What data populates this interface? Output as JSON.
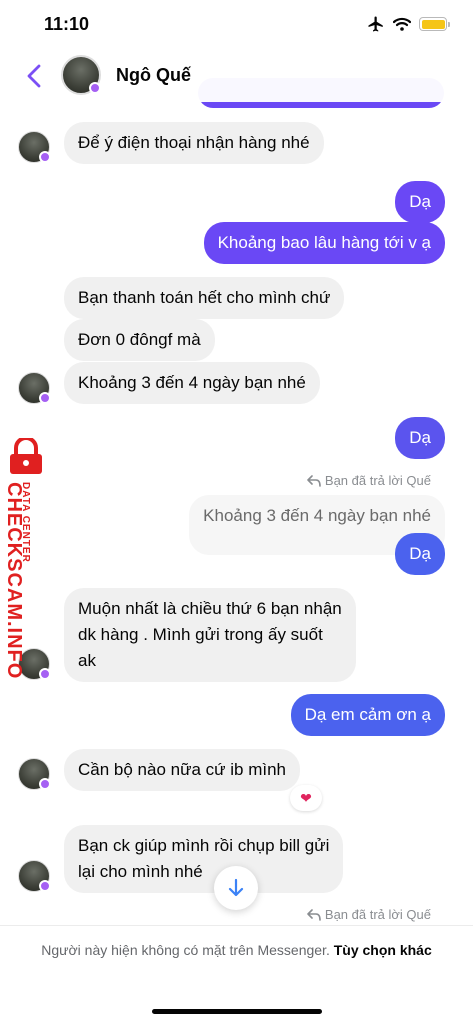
{
  "status_bar": {
    "time": "11:10"
  },
  "header": {
    "contact_name": "Ngô Quế"
  },
  "messages": [
    {
      "text": "Để ý điện thoại nhận hàng nhé"
    },
    {
      "text": "Dạ"
    },
    {
      "text": "Khoảng bao lâu hàng tới v ạ"
    },
    {
      "text": "Bạn thanh toán hết cho mình chứ"
    },
    {
      "text": "Đơn 0 đôngf mà"
    },
    {
      "text": "Khoảng 3 đến 4 ngày bạn nhé"
    },
    {
      "text": "Dạ"
    },
    {
      "text": "Khoảng 3 đến 4 ngày bạn nhé"
    },
    {
      "text": "Dạ"
    },
    {
      "line1": "Muộn nhất là chiều thứ 6 bạn nhận",
      "line2": "dk hàng . Mình gửi trong ấy suốt",
      "line3": "ak"
    },
    {
      "text": "Dạ em cảm ơn ạ"
    },
    {
      "text": "Cần bộ nào nữa cứ ib mình"
    },
    {
      "line1": "Bạn ck giúp mình rồi chụp bill gửi",
      "line2": "lại cho mình nhé"
    }
  ],
  "reply_labels": [
    "Bạn đã trả lời Quế",
    "Bạn đã trả lời Quế"
  ],
  "reaction": "❤",
  "watermark": {
    "text1": "DATA CENTER",
    "text2": "CHECKSCAM.INFO"
  },
  "footer": {
    "text": "Người này hiện không có mặt trên Messenger.",
    "link": "Tùy chọn khác"
  },
  "colors": {
    "accent": "#6a48f5",
    "incoming_bubble": "#f0f0f0",
    "watermark": "#e02020"
  },
  "icons": [
    "airplane-icon",
    "wifi-icon",
    "battery-icon",
    "back-chevron-icon",
    "reply-arrow-icon",
    "arrow-down-icon",
    "lock-icon"
  ]
}
